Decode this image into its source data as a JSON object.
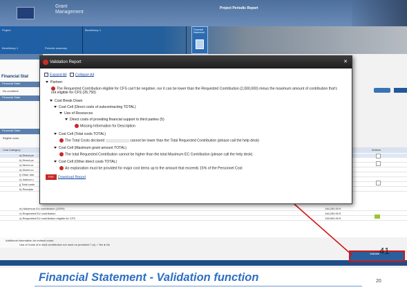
{
  "app": {
    "logo_text": "Grant Management",
    "window_title": "Project Periodic Report",
    "nav_segments": [
      "Project",
      "Beneficiary 1",
      "Financial Statement"
    ],
    "nav_sub": [
      "Beneficiary 1",
      "Periodic summary"
    ],
    "left_panel_title": "Financial Stat",
    "left_panel_sections": [
      "Financial State",
      "Financial State",
      "Financial State"
    ],
    "left_panel_text": [
      "No contributi",
      "Eligible costs"
    ],
    "table": {
      "header": [
        "Cost Category",
        "Actions"
      ],
      "rows": [
        {
          "label": "a) Direct pe",
          "amount": ""
        },
        {
          "label": "b) Direct pe",
          "amount": ""
        },
        {
          "label": "c) Direct co",
          "amount": ""
        },
        {
          "label": "d) Direct co",
          "amount": ""
        },
        {
          "label": "f) Other dire",
          "amount": ""
        },
        {
          "label": "e) Indirect c",
          "amount": ""
        },
        {
          "label": "j) Total costs",
          "amount": ""
        },
        {
          "label": "k) Receipts",
          "amount": ""
        },
        {
          "label": "m) Maximum EU contribution (100%)",
          "amount": "146,250.00 €"
        },
        {
          "label": "n) Requested EU contribution",
          "amount": "146,250.00 €"
        },
        {
          "label": "o) Requested EU contribution eligible for CFS",
          "amount": "135,500.00 €"
        }
      ]
    },
    "additional_info": "Additional information for indirect costs:",
    "additional_info_q": "Use of 'costs of in-kind contribution not used on premises'? (s)",
    "radio_yes": "Yes",
    "radio_no": "No",
    "validate_label": "Validate",
    "page_number_overlay": "41"
  },
  "modal": {
    "title": "Validation Report",
    "expand_all": "Expand All",
    "collapse_all": "Collapse All",
    "partner_label": "Partner:",
    "error_cfs": "The Requested Contribution eligible for CFS can't be negative, nor it can be lower than the Requested Contribution (2,000,000) minus the maximum amount of contribution that's not eligible for CFS (26,750)",
    "cost_breakdown": "Cost Break Down",
    "cost_cell_subcontracting": "Cost Cell (Direct costs of subcontracting TOTAL)",
    "use_of_resources": "Use of Resources",
    "direct_costs_fin": "Direct costs of providing financial support to third parties (5)",
    "missing_info": "Missing Information for Description",
    "cost_cell_total": "Cost Cell (Total costs TOTAL)",
    "error_total_a": "The Total Costs declared",
    "error_total_b": "cannot be lower than the Total Requested Contribution (please call the help desk)",
    "cost_cell_max": "Cost Cell (Maximum grant amount TOTAL)",
    "error_max": "The total Requested Contribution cannot be higher than the total Maximum EC Contribution (please call the help desk)",
    "cost_cell_other": "Cost Cell (Other direct costs TOTAL)",
    "error_other": "An explanation must be provided for major cost items up to the amount that exceeds 15% of the Personnel Cost",
    "pdf_badge": "PDF",
    "download_report": "Download Report"
  },
  "footer": {
    "slide_title": "Financial Statement - Validation function",
    "slide_number": "20"
  },
  "colors": {
    "accent": "#2e6fc4",
    "error": "#c62828",
    "highlight_box": "#d11414"
  }
}
